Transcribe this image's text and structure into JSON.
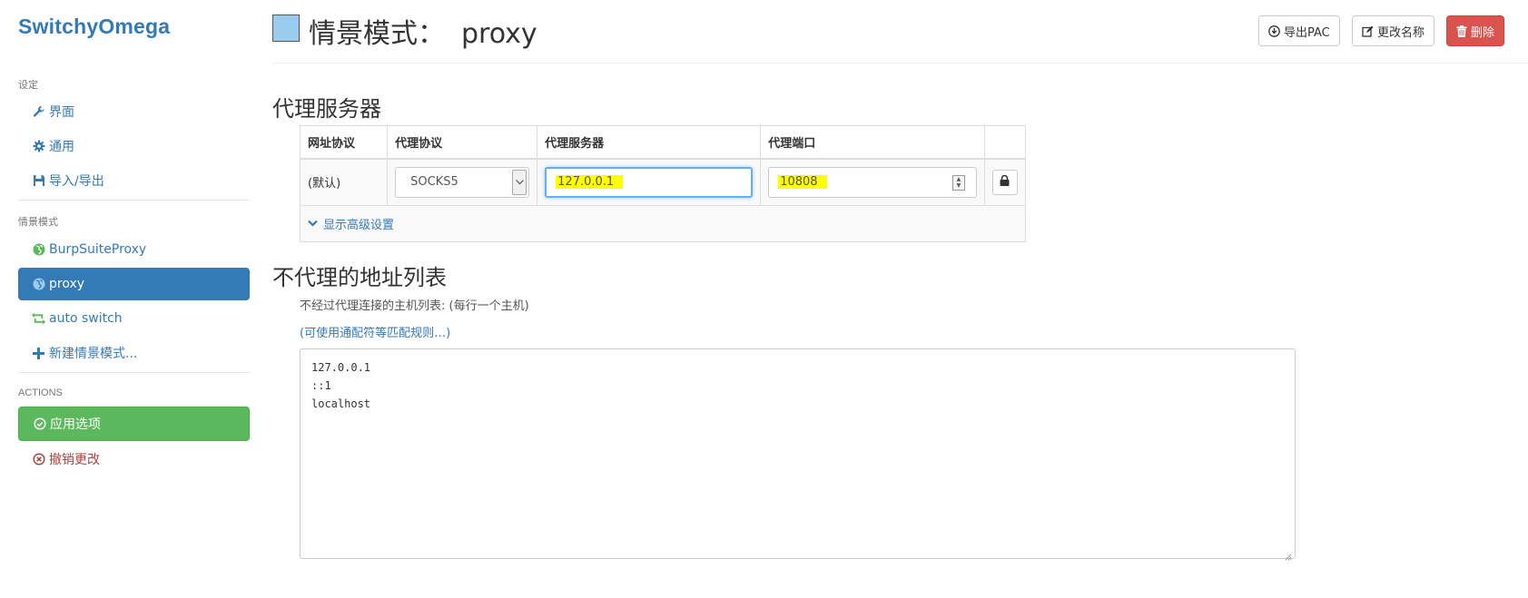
{
  "app": {
    "brand": "SwitchyOmega"
  },
  "sidebar": {
    "settings_title": "设定",
    "settings_items": [
      {
        "label": "界面",
        "icon": "wrench-icon"
      },
      {
        "label": "通用",
        "icon": "gear-icon"
      },
      {
        "label": "导入/导出",
        "icon": "floppy-icon"
      }
    ],
    "profiles_title": "情景模式",
    "profile_items": [
      {
        "label": "BurpSuiteProxy",
        "icon": "globe-icon",
        "color": "#5cb85c"
      },
      {
        "label": "proxy",
        "icon": "globe-icon",
        "color": "#99ccee",
        "active": true
      },
      {
        "label": "auto switch",
        "icon": "retweet-icon",
        "color": "#5cb85c"
      },
      {
        "label": "新建情景模式...",
        "icon": "plus-icon"
      }
    ],
    "actions_title": "ACTIONS",
    "apply_label": "应用选项",
    "discard_label": "撤销更改"
  },
  "header": {
    "title_prefix": "情景模式：",
    "profile_name": "proxy",
    "swatch_color": "#99ccee",
    "export_pac_label": "导出PAC",
    "rename_label": "更改名称",
    "delete_label": "删除"
  },
  "proxy_servers": {
    "heading": "代理服务器",
    "columns": [
      "网址协议",
      "代理协议",
      "代理服务器",
      "代理端口"
    ],
    "row": {
      "scheme": "(默认)",
      "protocol": "SOCKS5",
      "server": "127.0.0.1",
      "port": "10808"
    },
    "advanced_label": "显示高级设置"
  },
  "bypass": {
    "heading": "不代理的地址列表",
    "hint": "不经过代理连接的主机列表: (每行一个主机)",
    "rules_link": "(可使用通配符等匹配规则…)",
    "lines": [
      "127.0.0.1",
      "::1",
      "localhost"
    ]
  },
  "colors": {
    "primary": "#337ab7",
    "success": "#5cb85c",
    "danger": "#d9534f",
    "highlight": "#ffff00"
  }
}
